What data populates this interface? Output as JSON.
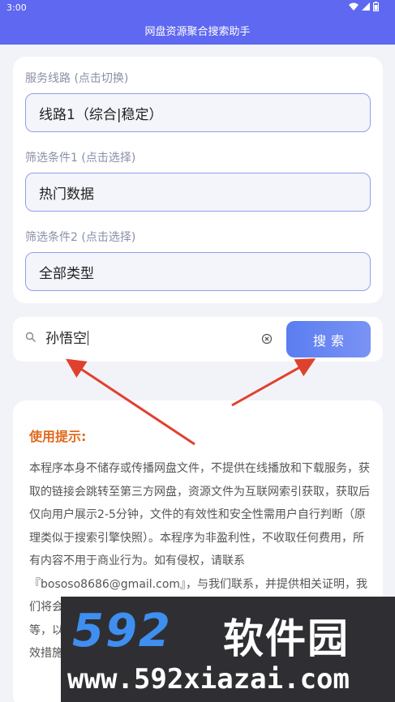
{
  "status_bar": {
    "time": "3:00"
  },
  "app": {
    "title": "网盘资源聚合搜索助手"
  },
  "filters": {
    "route_label": "服务线路 (点击切换)",
    "route_value": "线路1（综合|稳定）",
    "filter1_label": "筛选条件1 (点击选择)",
    "filter1_value": "热门数据",
    "filter2_label": "筛选条件2 (点击选择)",
    "filter2_value": "全部类型"
  },
  "search": {
    "query": "孙悟空",
    "button_label": "搜索"
  },
  "tips": {
    "title": "使用提示:",
    "body": "本程序本身不储存或传播网盘文件，不提供在线播放和下载服务，获取的链接会跳转至第三方网盘，资源文件为互联网索引获取，获取后仅向用户展示2-5分钟，文件的有效性和安全性需用户自行判断（原理类似于搜索引擎快照）。本程序为非盈利性，不收取任何费用，所有内容不用于商业行为。如有侵权，请联系『bososo8686@gmail.com』，与我们联系，并提供相关证明，我们将会在24小时内进行处理，但不限于删除相关内容，屏蔽关键词等，以防止侵权内容继续传播，包括但不限于删除、断开、屏蔽等有效措施。"
  },
  "watermark": {
    "number": "592",
    "name": "软件园",
    "url": "www.592xiazai.com"
  },
  "colors": {
    "appbar": "#5f68f0",
    "accent": "#5a7df0",
    "tips_title": "#e06a1c",
    "arrow": "#e0412e"
  }
}
